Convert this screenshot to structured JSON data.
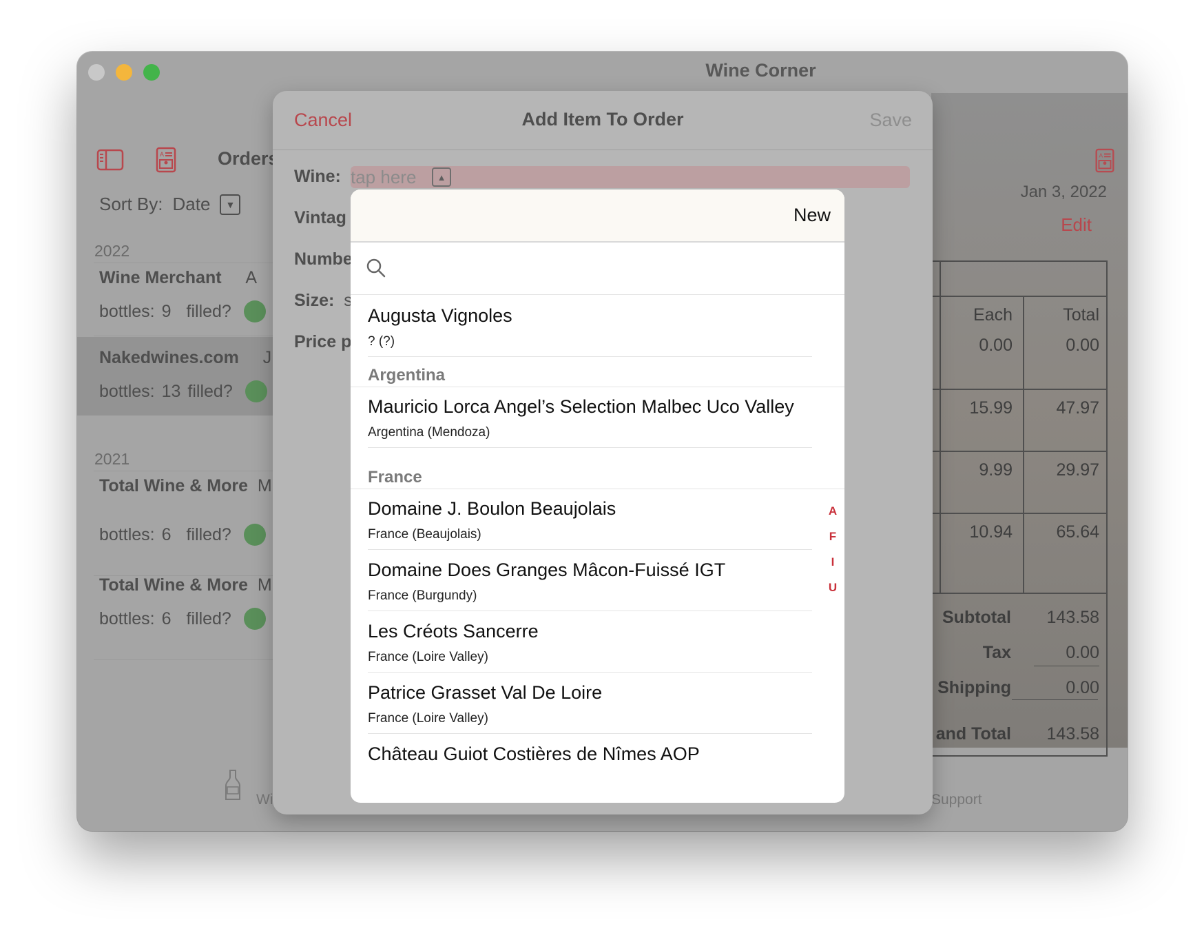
{
  "window": {
    "title": "Wine Corner"
  },
  "sidebar": {
    "title": "Orders",
    "sort_label": "Sort By:",
    "sort_value": "Date",
    "groups": [
      {
        "year": "2022",
        "orders": [
          {
            "name": "Wine Merchant",
            "trail": "A",
            "bottles_label": "bottles:",
            "bottles": "9",
            "filled_label": "filled?"
          },
          {
            "name": "Nakedwines.com",
            "trail": "J",
            "bottles_label": "bottles:",
            "bottles": "13",
            "filled_label": "filled?"
          }
        ]
      },
      {
        "year": "2021",
        "orders": [
          {
            "name": "Total Wine & More",
            "trail": "M",
            "bottles_label": "bottles:",
            "bottles": "6",
            "filled_label": "filled?"
          },
          {
            "name": "Total Wine & More",
            "trail": "M",
            "bottles_label": "bottles:",
            "bottles": "6",
            "filled_label": "filled?"
          }
        ]
      }
    ]
  },
  "detail": {
    "date": "Jan 3, 2022",
    "edit_label": "Edit",
    "columns": {
      "each": "Each",
      "total": "Total"
    },
    "rows": [
      {
        "each": "0.00",
        "total": "0.00"
      },
      {
        "each": "15.99",
        "total": "47.97"
      },
      {
        "each": "9.99",
        "total": "29.97"
      },
      {
        "each": "10.94",
        "total": "65.64"
      }
    ],
    "summary": [
      {
        "label": "Subtotal",
        "value": "143.58"
      },
      {
        "label": "Tax",
        "value": "0.00"
      },
      {
        "label": "Shipping",
        "value": "0.00"
      },
      {
        "label": "and Total",
        "value": "143.58"
      }
    ]
  },
  "tabbar": {
    "wines_label": "Wi",
    "support_label": "Support"
  },
  "modal": {
    "cancel_label": "Cancel",
    "title": "Add Item To Order",
    "save_label": "Save",
    "wine_label": "Wine:",
    "wine_placeholder": "tap here",
    "vintage_label": "Vintag",
    "number_label": "Numbe",
    "size_label": "Size:",
    "size_value": "s",
    "price_label": "Price p"
  },
  "picker": {
    "new_label": "New",
    "search_placeholder": "",
    "ungrouped": [
      {
        "name": "Augusta Vignoles",
        "sub": "? (?)"
      }
    ],
    "sections": [
      {
        "title": "Argentina",
        "wines": [
          {
            "name": "Mauricio Lorca Angel’s Selection Malbec Uco Valley",
            "sub": "Argentina (Mendoza)"
          }
        ]
      },
      {
        "title": "France",
        "wines": [
          {
            "name": "Domaine J. Boulon Beaujolais",
            "sub": "France (Beaujolais)"
          },
          {
            "name": "Domaine Does Granges Mâcon-Fuissé IGT",
            "sub": "France (Burgundy)"
          },
          {
            "name": "Les Créots Sancerre",
            "sub": "France (Loire Valley)"
          },
          {
            "name": "Patrice Grasset Val De Loire",
            "sub": "France (Loire Valley)"
          },
          {
            "name": "Château Guiot Costières de Nîmes AOP",
            "sub": ""
          }
        ]
      }
    ],
    "index_letters": [
      "A",
      "F",
      "I",
      "U"
    ]
  },
  "colors": {
    "accent": "#b8474d",
    "index": "#c9303a",
    "filled_dot": "#5a8f5a",
    "dim": "#a5a5a5"
  }
}
